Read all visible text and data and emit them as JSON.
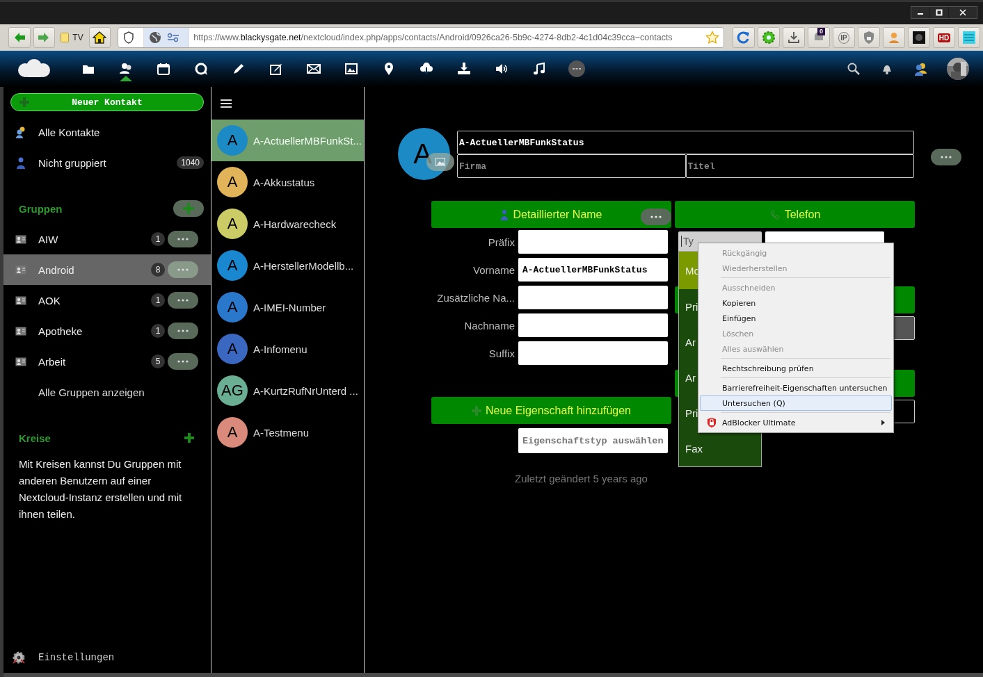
{
  "browser": {
    "bookmark": "TV",
    "url": {
      "prefix": "https://www.",
      "domain": "blackysgate.net",
      "path": "/nextcloud/index.php/apps/contacts/Android/0926ca26-5b9c-4274-8db2-4c1d04c39cca~contacts"
    },
    "extensions": [
      {
        "kind": "reload"
      },
      {
        "kind": "gear"
      },
      {
        "kind": "download"
      },
      {
        "kind": "notify",
        "badge": "0"
      },
      {
        "kind": "ip",
        "label": "IP"
      },
      {
        "kind": "shield"
      },
      {
        "kind": "spy"
      },
      {
        "kind": "dark"
      },
      {
        "kind": "hd",
        "label": "HD"
      },
      {
        "kind": "menu"
      }
    ]
  },
  "appbar": {
    "apps": [
      {
        "kind": "files",
        "selected": false
      },
      {
        "kind": "contacts",
        "selected": true
      },
      {
        "kind": "calendar",
        "selected": false
      },
      {
        "kind": "talk",
        "selected": false
      },
      {
        "kind": "pen",
        "selected": false
      },
      {
        "kind": "notes",
        "selected": false
      },
      {
        "kind": "mail",
        "selected": false
      },
      {
        "kind": "gallery",
        "selected": false
      },
      {
        "kind": "maps",
        "selected": false
      },
      {
        "kind": "cloud",
        "selected": false
      },
      {
        "kind": "download",
        "selected": false
      },
      {
        "kind": "audio",
        "selected": false
      },
      {
        "kind": "music",
        "selected": false
      },
      {
        "kind": "more",
        "selected": false
      }
    ],
    "right": [
      {
        "kind": "search"
      },
      {
        "kind": "bell"
      },
      {
        "kind": "people"
      },
      {
        "kind": "avatar"
      }
    ]
  },
  "sidebar": {
    "new_contact": "Neuer Kontakt",
    "items": [
      {
        "kind": "all",
        "label": "Alle Kontakte"
      },
      {
        "kind": "ungrouped",
        "label": "Nicht gruppiert",
        "count": "1040"
      }
    ],
    "groups_title": "Gruppen",
    "groups": [
      {
        "label": "AIW",
        "count": "1",
        "selected": false
      },
      {
        "label": "Android",
        "count": "8",
        "selected": true
      },
      {
        "label": "AOK",
        "count": "1",
        "selected": false
      },
      {
        "label": "Apotheke",
        "count": "1",
        "selected": false
      },
      {
        "label": "Arbeit",
        "count": "5",
        "selected": false
      }
    ],
    "show_all": "Alle Gruppen anzeigen",
    "circles_title": "Kreise",
    "circles_text": "Mit Kreisen kannst Du Gruppen mit anderen Benutzern auf einer Nextcloud-Instanz erstellen und mit ihnen teilen.",
    "settings": "Einstellungen"
  },
  "contacts": [
    {
      "initials": "A",
      "name": "A-ActuellerMBFunkSt...",
      "color": "#1c8ac4",
      "selected": true
    },
    {
      "initials": "A",
      "name": "A-Akkustatus",
      "color": "#e2b45a",
      "selected": false
    },
    {
      "initials": "A",
      "name": "A-Hardwarecheck",
      "color": "#cccc66",
      "selected": false
    },
    {
      "initials": "A",
      "name": "A-HerstellerModellb...",
      "color": "#1a88d0",
      "selected": false
    },
    {
      "initials": "A",
      "name": "A-IMEI-Number",
      "color": "#2a78cc",
      "selected": false
    },
    {
      "initials": "A",
      "name": "A-Infomenu",
      "color": "#3a68c0",
      "selected": false
    },
    {
      "initials": "AG",
      "name": "A-KurtzRufNrUnterd ...",
      "color": "#6aae94",
      "selected": false
    },
    {
      "initials": "A",
      "name": "A-Testmenu",
      "color": "#d98a7a",
      "selected": false
    }
  ],
  "detail": {
    "avatar_initial": "A",
    "full_name": "A-ActuellerMBFunkStatus",
    "company_placeholder": "Firma",
    "title_placeholder": "Titel",
    "name_section": {
      "title": "Detaillierter Name",
      "fields": [
        {
          "label": "Präfix"
        },
        {
          "label": "Vorname",
          "value": "A-ActuellerMBFunkStatus"
        },
        {
          "label": "Zusätzliche Na..."
        },
        {
          "label": "Nachname"
        },
        {
          "label": "Suffix"
        }
      ]
    },
    "add_property": {
      "title": "Neue Eigenschaft hinzufügen",
      "placeholder": "Eigenschaftstyp auswählen"
    },
    "phone": {
      "title": "Telefon",
      "type_select": "Ty",
      "options": [
        {
          "label": "Mo",
          "selected": true
        },
        {
          "label": "Pri",
          "selected": false
        },
        {
          "label": "Ar",
          "selected": false
        },
        {
          "label": "Ar",
          "selected": false
        },
        {
          "label": "Pri",
          "selected": false
        },
        {
          "label": "Fax",
          "selected": false
        }
      ]
    },
    "modified": "Zuletzt geändert 5 years ago"
  },
  "context_menu": [
    {
      "kind": "item",
      "label": "Rückgängig",
      "disabled": true,
      "selected": false
    },
    {
      "kind": "item",
      "label": "Wiederherstellen",
      "disabled": true,
      "selected": false
    },
    {
      "kind": "separator"
    },
    {
      "kind": "item",
      "label": "Ausschneiden",
      "disabled": true,
      "selected": false
    },
    {
      "kind": "item",
      "label": "Kopieren",
      "disabled": false,
      "selected": false
    },
    {
      "kind": "item",
      "label": "Einfügen",
      "disabled": false,
      "selected": false
    },
    {
      "kind": "item",
      "label": "Löschen",
      "disabled": true,
      "selected": false
    },
    {
      "kind": "item",
      "label": "Alles auswählen",
      "disabled": true,
      "selected": false
    },
    {
      "kind": "separator"
    },
    {
      "kind": "item",
      "label": "Rechtschreibung prüfen",
      "disabled": false,
      "selected": false
    },
    {
      "kind": "separator"
    },
    {
      "kind": "item",
      "label": "Barrierefreiheit-Eigenschaften untersuchen",
      "disabled": false,
      "selected": false
    },
    {
      "kind": "item",
      "label": "Untersuchen (Q)",
      "disabled": false,
      "selected": true
    },
    {
      "kind": "separator"
    },
    {
      "kind": "submenu",
      "label": "AdBlocker Ultimate",
      "disabled": false,
      "selected": false
    }
  ]
}
